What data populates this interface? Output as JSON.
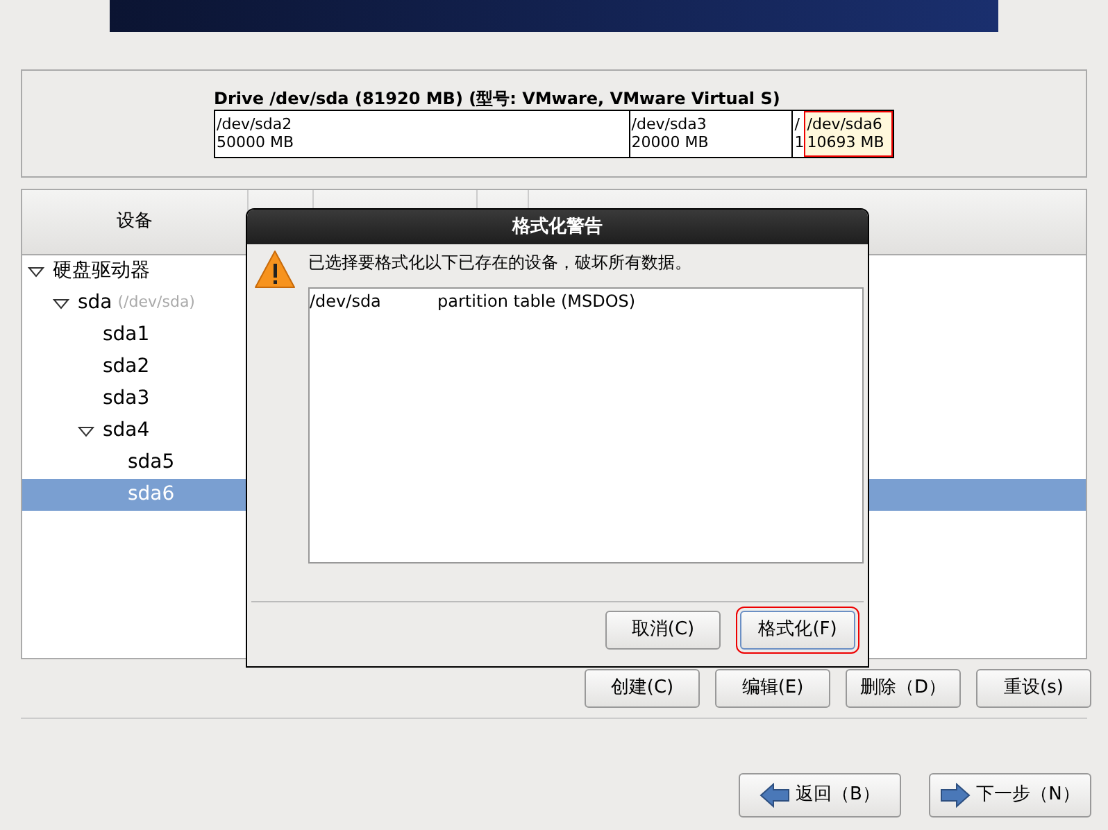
{
  "drive": {
    "title": "Drive /dev/sda (81920 MB) (型号: VMware, VMware Virtual S)",
    "segments": [
      {
        "name": "/dev/sda2",
        "size": "50000 MB",
        "selected": false
      },
      {
        "name": "/dev/sda3",
        "size": "20000 MB",
        "selected": false
      },
      {
        "name": "/",
        "size": "1",
        "selected": false
      },
      {
        "name": "/dev/sda6",
        "size": "10693 MB",
        "selected": true
      }
    ]
  },
  "table": {
    "columns": [
      "设备"
    ],
    "rows": [
      {
        "label": "硬盘驱动器",
        "expanded": true,
        "selected": false,
        "children": [
          {
            "label": "sda",
            "note": "(/dev/sda)",
            "expanded": true,
            "selected": false,
            "children": [
              {
                "label": "sda1",
                "selected": false
              },
              {
                "label": "sda2",
                "selected": false
              },
              {
                "label": "sda3",
                "selected": false
              },
              {
                "label": "sda4",
                "expanded": true,
                "selected": false,
                "children": [
                  {
                    "label": "sda5",
                    "selected": false
                  },
                  {
                    "label": "sda6",
                    "selected": true
                  }
                ]
              }
            ]
          }
        ]
      }
    ]
  },
  "dialog": {
    "title": "格式化警告",
    "message": "已选择要格式化以下已存在的设备，破坏所有数据。",
    "items": [
      {
        "device": "/dev/sda",
        "description": "partition table (MSDOS)"
      }
    ],
    "buttons": [
      {
        "label": "取消(C)",
        "selected": false
      },
      {
        "label": "格式化(F)",
        "selected": true
      }
    ]
  },
  "actions": [
    "创建(C)",
    "编辑(E)",
    "删除（D）",
    "重设(s)"
  ],
  "nav": [
    {
      "label": "返回（B）",
      "kind": "back"
    },
    {
      "label": "下一步（N）",
      "kind": "next"
    }
  ]
}
